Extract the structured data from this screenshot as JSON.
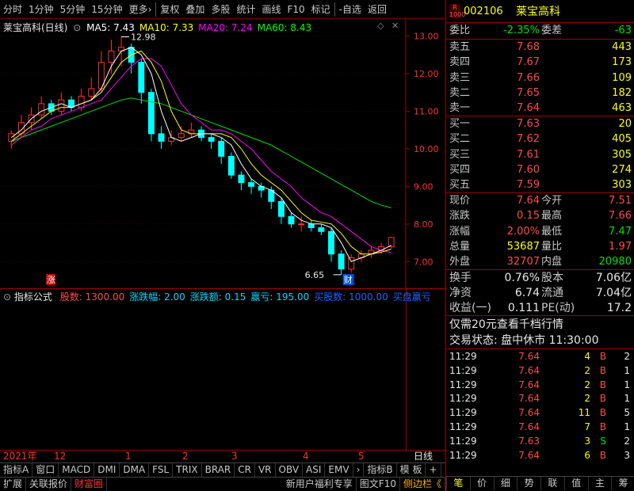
{
  "toolbar": {
    "items": [
      "分时",
      "1分钟",
      "5分钟",
      "15分钟",
      "更多›",
      "复权",
      "叠加",
      "多股",
      "统计",
      "画线",
      "F10",
      "标记",
      "-自选",
      "返回"
    ]
  },
  "chart": {
    "title": "莱宝高科(日线)",
    "ma": [
      {
        "label": "MA5: 7.43",
        "color": "#ffffff"
      },
      {
        "label": "MA10: 7.33",
        "color": "#ffff00"
      },
      {
        "label": "MA20: 7.24",
        "color": "#ff00ff"
      },
      {
        "label": "MA60: 8.43",
        "color": "#00ff00"
      }
    ],
    "high_label": "12.98",
    "low_label": "6.65",
    "badge_zhang": "涨",
    "badge_cai": "财",
    "y_ticks": [
      "13.00",
      "12.00",
      "11.00",
      "10.00",
      "9.00",
      "8.00",
      "7.00"
    ]
  },
  "chart_data": {
    "type": "candlestick",
    "ylim": [
      6.5,
      13.2
    ],
    "y_ticks": [
      13,
      12,
      11,
      10,
      9,
      8,
      7
    ],
    "ma5": [
      10.3,
      10.5,
      10.8,
      11.0,
      11.1,
      11.2,
      11.1,
      11.2,
      11.3,
      11.6,
      12.2,
      12.6,
      12.7,
      12.5,
      12.0,
      11.0,
      10.3,
      10.2,
      10.3,
      10.4,
      10.4,
      10.3,
      10.1,
      9.6,
      9.2,
      9.0,
      8.9,
      8.7,
      8.3,
      8.1,
      8.0,
      8.0,
      7.9,
      7.5,
      7.0,
      7.1,
      7.2,
      7.3,
      7.43
    ],
    "ma10": [
      10.2,
      10.4,
      10.6,
      10.8,
      11.0,
      11.1,
      11.1,
      11.2,
      11.3,
      11.5,
      11.9,
      12.3,
      12.5,
      12.6,
      12.3,
      11.8,
      11.0,
      10.5,
      10.4,
      10.4,
      10.4,
      10.4,
      10.3,
      10.0,
      9.6,
      9.3,
      9.1,
      8.9,
      8.6,
      8.3,
      8.1,
      8.05,
      8.0,
      7.75,
      7.4,
      7.2,
      7.2,
      7.25,
      7.33
    ],
    "ma20": [
      10.1,
      10.3,
      10.5,
      10.6,
      10.8,
      10.9,
      11.0,
      11.1,
      11.2,
      11.3,
      11.6,
      11.9,
      12.2,
      12.4,
      12.4,
      12.2,
      11.7,
      11.2,
      10.9,
      10.7,
      10.5,
      10.5,
      10.4,
      10.2,
      10.0,
      9.7,
      9.4,
      9.2,
      9.0,
      8.7,
      8.5,
      8.3,
      8.2,
      8.0,
      7.8,
      7.6,
      7.4,
      7.3,
      7.24
    ],
    "ma60": [
      10.2,
      10.3,
      10.4,
      10.5,
      10.6,
      10.7,
      10.8,
      10.9,
      11.0,
      11.1,
      11.2,
      11.3,
      11.35,
      11.3,
      11.25,
      11.2,
      11.1,
      11.0,
      10.9,
      10.8,
      10.7,
      10.6,
      10.5,
      10.4,
      10.3,
      10.2,
      10.1,
      9.95,
      9.8,
      9.65,
      9.5,
      9.35,
      9.2,
      9.05,
      8.9,
      8.75,
      8.6,
      8.5,
      8.43
    ],
    "candles": [
      [
        10.2,
        10.4,
        10.0,
        10.5
      ],
      [
        10.4,
        10.7,
        10.3,
        10.9
      ],
      [
        10.7,
        10.9,
        10.5,
        11.1
      ],
      [
        10.9,
        11.2,
        10.8,
        11.4
      ],
      [
        11.2,
        11.0,
        10.9,
        11.3
      ],
      [
        11.0,
        11.3,
        10.9,
        11.5
      ],
      [
        11.3,
        11.1,
        11.0,
        11.4
      ],
      [
        11.1,
        11.4,
        11.0,
        11.6
      ],
      [
        11.4,
        11.6,
        11.3,
        11.9
      ],
      [
        11.6,
        12.3,
        11.5,
        12.6
      ],
      [
        12.3,
        12.6,
        12.0,
        12.9
      ],
      [
        12.6,
        12.7,
        12.2,
        12.98
      ],
      [
        12.7,
        12.3,
        12.0,
        12.8
      ],
      [
        12.3,
        11.5,
        11.2,
        12.4
      ],
      [
        11.5,
        10.4,
        10.2,
        11.6
      ],
      [
        10.4,
        10.2,
        10.0,
        10.6
      ],
      [
        10.2,
        10.3,
        10.1,
        10.5
      ],
      [
        10.3,
        10.4,
        10.2,
        10.6
      ],
      [
        10.4,
        10.5,
        10.3,
        10.7
      ],
      [
        10.5,
        10.3,
        10.2,
        10.6
      ],
      [
        10.3,
        10.2,
        10.0,
        10.4
      ],
      [
        10.2,
        9.8,
        9.6,
        10.3
      ],
      [
        9.8,
        9.3,
        9.2,
        9.9
      ],
      [
        9.3,
        9.1,
        8.9,
        9.4
      ],
      [
        9.1,
        9.0,
        8.8,
        9.2
      ],
      [
        9.0,
        8.9,
        8.7,
        9.1
      ],
      [
        8.9,
        8.6,
        8.4,
        9.0
      ],
      [
        8.6,
        8.2,
        8.0,
        8.7
      ],
      [
        8.2,
        8.0,
        7.9,
        8.3
      ],
      [
        8.0,
        8.0,
        7.8,
        8.2
      ],
      [
        8.0,
        7.9,
        7.8,
        8.1
      ],
      [
        7.9,
        7.8,
        7.7,
        8.0
      ],
      [
        7.8,
        7.2,
        7.0,
        7.9
      ],
      [
        7.2,
        6.8,
        6.65,
        7.3
      ],
      [
        6.8,
        7.1,
        6.7,
        7.2
      ],
      [
        7.1,
        7.2,
        7.0,
        7.3
      ],
      [
        7.2,
        7.3,
        7.1,
        7.4
      ],
      [
        7.3,
        7.4,
        7.2,
        7.5
      ],
      [
        7.4,
        7.64,
        7.35,
        7.66
      ]
    ]
  },
  "indicator": {
    "label": "指标公式",
    "values": [
      {
        "text": "股数: 1300.00",
        "color": "#ff4a4a"
      },
      {
        "text": "涨跌幅: 2.00",
        "color": "#00d8ff"
      },
      {
        "text": "涨跌额: 0.15",
        "color": "#00d8ff"
      },
      {
        "text": "赢亏: 195.00",
        "color": "#00d8ff"
      },
      {
        "text": "买股数: 1000.00",
        "color": "#2060ff"
      },
      {
        "text": "买盘赢亏",
        "color": "#2060ff"
      }
    ]
  },
  "dates": {
    "year": "2021年",
    "m1": "12",
    "m2": "1",
    "m3": "2",
    "m4": "3",
    "m5": "4",
    "m6": "5"
  },
  "tabs1": [
    "指标A",
    "窗口",
    "MACD",
    "DMI",
    "DMA",
    "FSL",
    "TRIX",
    "BRAR",
    "CR",
    "VR",
    "OBV",
    "ASI",
    "EMV",
    "›",
    "指标B",
    "模 板",
    "+",
    "−"
  ],
  "tabs2": [
    "扩展",
    "关联报价",
    "财富圈"
  ],
  "tabs2_right": [
    "新用户福利专享",
    "图文F10",
    "侧边栏《"
  ],
  "quote": {
    "r_badge": "R",
    "r_badge_sub": "1000",
    "code": "002106",
    "name": "莱宝高科",
    "weibi_label": "委比",
    "weibi": "-2.35%",
    "weicha_label": "委差",
    "weicha": "-63",
    "asks": [
      {
        "label": "卖五",
        "price": "7.68",
        "vol": "443"
      },
      {
        "label": "卖四",
        "price": "7.67",
        "vol": "173"
      },
      {
        "label": "卖三",
        "price": "7.66",
        "vol": "109"
      },
      {
        "label": "卖二",
        "price": "7.65",
        "vol": "182"
      },
      {
        "label": "卖一",
        "price": "7.64",
        "vol": "463"
      }
    ],
    "bids": [
      {
        "label": "买一",
        "price": "7.63",
        "vol": "20"
      },
      {
        "label": "买二",
        "price": "7.62",
        "vol": "405"
      },
      {
        "label": "买三",
        "price": "7.61",
        "vol": "305"
      },
      {
        "label": "买四",
        "price": "7.60",
        "vol": "274"
      },
      {
        "label": "买五",
        "price": "7.59",
        "vol": "303"
      }
    ],
    "stats": [
      {
        "l1": "现价",
        "v1": "7.64",
        "c1": "red",
        "l2": "今开",
        "v2": "7.51",
        "c2": "red"
      },
      {
        "l1": "涨跌",
        "v1": "0.15",
        "c1": "red",
        "l2": "最高",
        "v2": "7.66",
        "c2": "red"
      },
      {
        "l1": "涨幅",
        "v1": "2.00%",
        "c1": "red",
        "l2": "最低",
        "v2": "7.47",
        "c2": "green"
      },
      {
        "l1": "总量",
        "v1": "53687",
        "c1": "yel",
        "l2": "量比",
        "v2": "1.97",
        "c2": "red"
      },
      {
        "l1": "外盘",
        "v1": "32707",
        "c1": "red",
        "l2": "内盘",
        "v2": "20980",
        "c2": "green"
      }
    ],
    "stats2": [
      {
        "l1": "换手",
        "v1": "0.76%",
        "l2": "股本",
        "v2": "7.06亿"
      },
      {
        "l1": "净资",
        "v1": "6.74",
        "l2": "流通",
        "v2": "7.04亿"
      },
      {
        "l1": "收益(一)",
        "v1": "0.111",
        "l2": "PE(动)",
        "v2": "17.2"
      }
    ],
    "promo": "仅需20元查看千档行情",
    "status": "交易状态: 盘中休市  11:30:00",
    "ticks": [
      {
        "t": "11:29",
        "p": "7.64",
        "v": "4",
        "s": "B",
        "n": "2"
      },
      {
        "t": "11:29",
        "p": "7.64",
        "v": "2",
        "s": "B",
        "n": "1"
      },
      {
        "t": "11:29",
        "p": "7.64",
        "v": "2",
        "s": "B",
        "n": "1"
      },
      {
        "t": "11:29",
        "p": "7.64",
        "v": "2",
        "s": "B",
        "n": "1"
      },
      {
        "t": "11:29",
        "p": "7.64",
        "v": "11",
        "s": "B",
        "n": "5"
      },
      {
        "t": "11:29",
        "p": "7.64",
        "v": "7",
        "s": "B",
        "n": "1"
      },
      {
        "t": "11:29",
        "p": "7.63",
        "v": "3",
        "s": "S",
        "n": "2"
      },
      {
        "t": "11:29",
        "p": "7.64",
        "v": "6",
        "s": "B",
        "n": "3"
      }
    ],
    "bottom_tabs": [
      "笔",
      "价",
      "细",
      "势",
      "联",
      "值",
      "主",
      "筹"
    ]
  }
}
